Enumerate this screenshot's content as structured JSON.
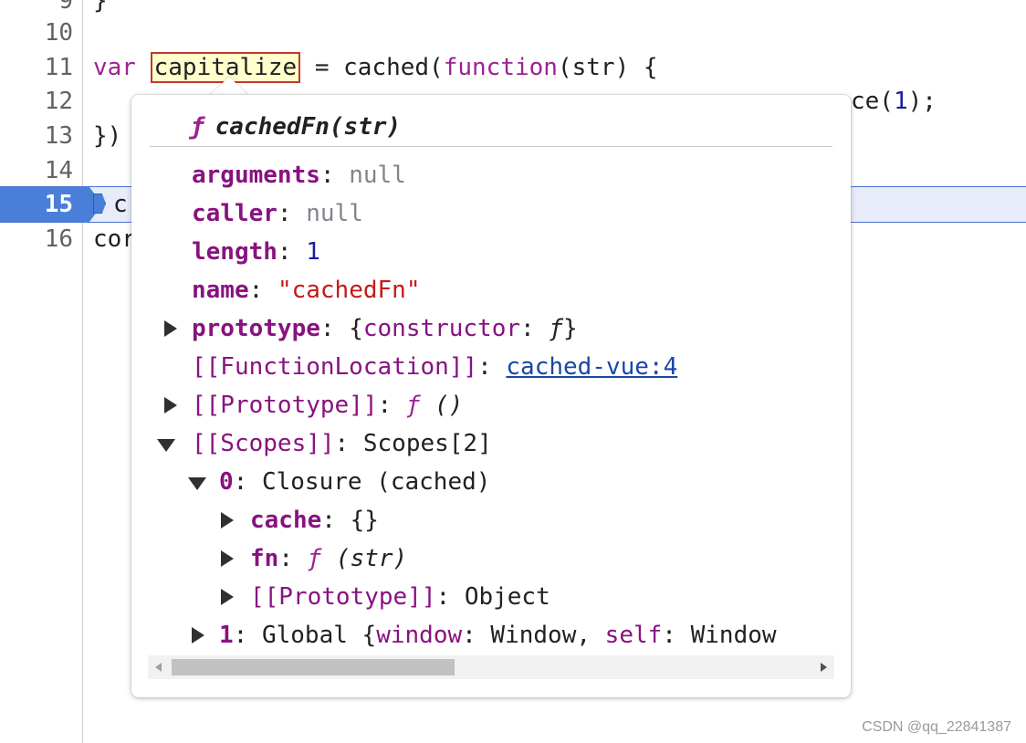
{
  "editor": {
    "line_numbers": [
      "9",
      "10",
      "11",
      "12",
      "13",
      "14",
      "15",
      "16"
    ],
    "line9": "}",
    "line11_var": "var",
    "line11_name": "capitalize",
    "line11_eq": " = cached(",
    "line11_function": "function",
    "line11_rest": "(str) {",
    "line12_tail_a": "ce(",
    "line12_num": "1",
    "line12_tail_b": ");",
    "line13": "})",
    "line15_char": "c",
    "line16": "cor"
  },
  "popover": {
    "title_symbol": "ƒ",
    "title": "cachedFn(str)",
    "props": {
      "arguments": {
        "key": "arguments",
        "sep": ": ",
        "value": "null"
      },
      "caller": {
        "key": "caller",
        "sep": ": ",
        "value": "null"
      },
      "length": {
        "key": "length",
        "sep": ": ",
        "value": "1"
      },
      "name": {
        "key": "name",
        "sep": ": ",
        "value": "\"cachedFn\""
      },
      "prototype": {
        "key": "prototype",
        "sep": ": ",
        "value_a": "{",
        "value_key": "constructor",
        "value_sep": ": ",
        "value_f": "ƒ",
        "value_b": "}"
      },
      "function_location": {
        "key": "[[FunctionLocation]]",
        "sep": ": ",
        "link": "cached-vue:4"
      },
      "proto": {
        "key": "[[Prototype]]",
        "sep": ": ",
        "f": "ƒ",
        "value": " ()"
      },
      "scopes": {
        "key": "[[Scopes]]",
        "sep": ": ",
        "value": "Scopes[2]"
      },
      "scope0": {
        "key": "0",
        "sep": ": ",
        "value": "Closure (cached)"
      },
      "cache": {
        "key": "cache",
        "sep": ": ",
        "value": "{}"
      },
      "fn": {
        "key": "fn",
        "sep": ": ",
        "f": "ƒ",
        "value": " (str)"
      },
      "scope0_proto": {
        "key": "[[Prototype]]",
        "sep": ": ",
        "value": "Object"
      },
      "scope1": {
        "key": "1",
        "sep": ": ",
        "value_a": "Global {",
        "k1": "window",
        "s1": ": Window, ",
        "k2": "self",
        "s2": ": Window"
      }
    }
  },
  "watermark": "CSDN @qq_22841387"
}
